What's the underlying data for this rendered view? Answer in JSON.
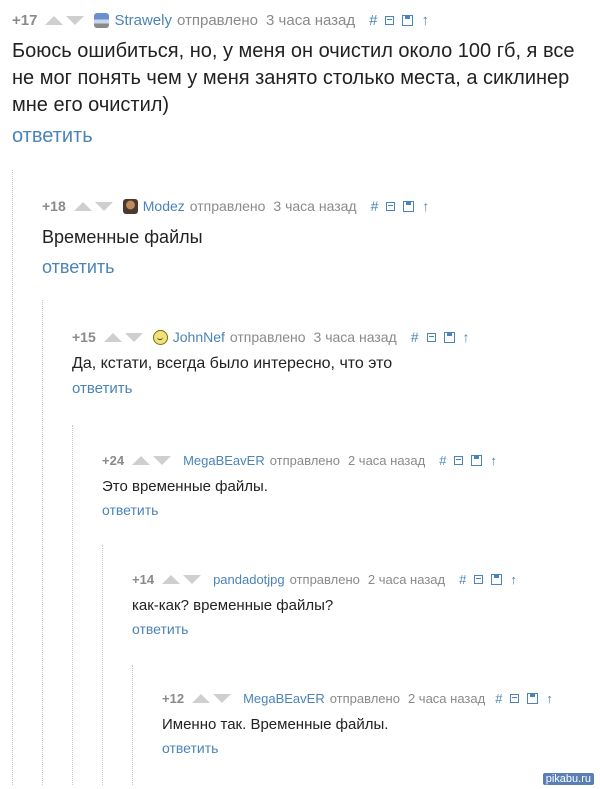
{
  "comments": [
    {
      "rating": "+17",
      "author": "Strawely",
      "posted": "отправлено",
      "time": "3 часа назад",
      "permalink": "#",
      "text": "Боюсь ошибиться, но, у меня он очистил около 100 гб, я все не мог понять чем у меня занято столько места, а сиклинер мне его очистил)",
      "reply": "ответить",
      "avatar": "car-avatar"
    },
    {
      "rating": "+18",
      "author": "Modez",
      "posted": "отправлено",
      "time": "3 часа назад",
      "permalink": "#",
      "text": "Временные файлы",
      "reply": "ответить",
      "avatar": "photo-avatar"
    },
    {
      "rating": "+15",
      "author": "JohnNef",
      "posted": "отправлено",
      "time": "3 часа назад",
      "permalink": "#",
      "text": "Да, кстати, всегда было интересно, что это",
      "reply": "ответить",
      "avatar": "smiley-avatar"
    },
    {
      "rating": "+24",
      "author": "MegaBEavER",
      "posted": "отправлено",
      "time": "2 часа назад",
      "permalink": "#",
      "text": "Это временные файлы.",
      "reply": "ответить",
      "avatar": ""
    },
    {
      "rating": "+14",
      "author": "pandadotjpg",
      "posted": "отправлено",
      "time": "2 часа назад",
      "permalink": "#",
      "text": "как-как? временные файлы?",
      "reply": "ответить",
      "avatar": ""
    },
    {
      "rating": "+12",
      "author": "MegaBEavER",
      "posted": "отправлено",
      "time": "2 часа назад",
      "permalink": "#",
      "text": "Именно так. Временные файлы.",
      "reply": "ответить",
      "avatar": ""
    }
  ],
  "watermark": "pikabu.ru",
  "colors": {
    "link": "#4a84b8",
    "meta": "#8a8a8a",
    "text": "#222222",
    "arrow": "#cfcfcf"
  }
}
